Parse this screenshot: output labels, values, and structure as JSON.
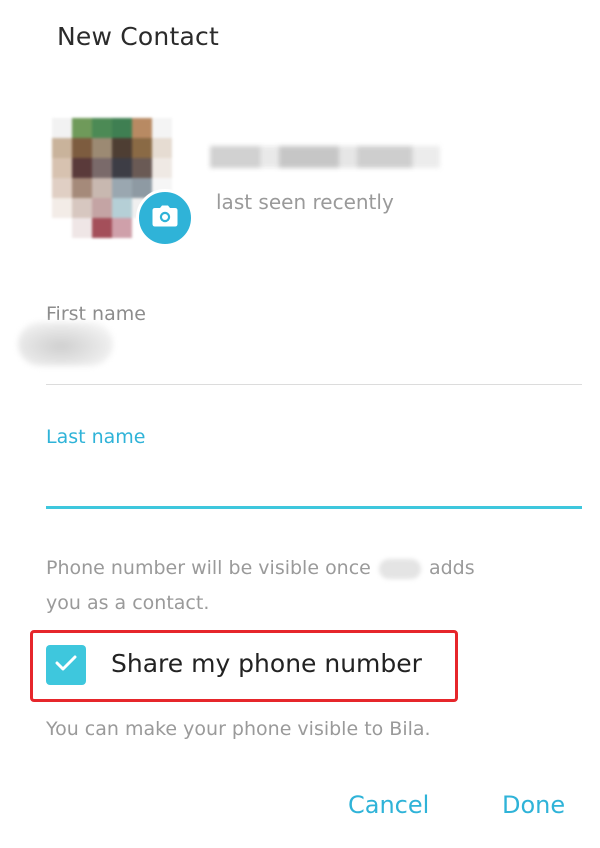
{
  "dialog": {
    "title": "New Contact"
  },
  "profile": {
    "last_seen": "last seen recently",
    "avatar_icon": "camera-icon",
    "accent_color": "#2fb3d8"
  },
  "form": {
    "first_name_label": "First name",
    "last_name_label": "Last name",
    "last_name_value": ""
  },
  "privacy": {
    "info_part1": "Phone number will be visible once",
    "info_part2": "adds",
    "info_line2": "you as a contact.",
    "share_label": "Share my phone number",
    "share_checked": true,
    "hint": "You can make your phone visible to Bila."
  },
  "actions": {
    "cancel_label": "Cancel",
    "done_label": "Done"
  }
}
